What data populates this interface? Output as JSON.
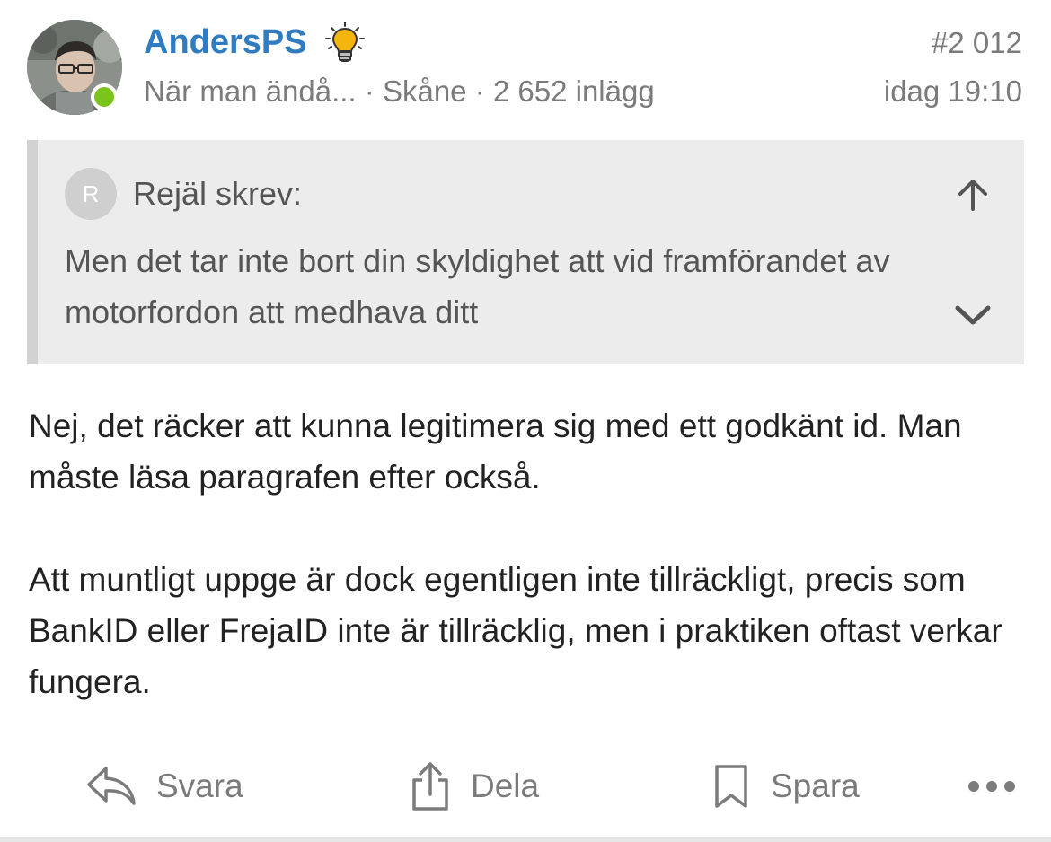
{
  "post": {
    "username": "AndersPS",
    "user_title": "När man ändå...",
    "location": "Skåne",
    "post_count": "2 652 inlägg",
    "separator": " · ",
    "post_number": "#2 012",
    "timestamp": "idag 19:10",
    "online": true,
    "badge_icon": "lightbulb-icon"
  },
  "quote": {
    "avatar_letter": "R",
    "author_line": "Rejäl skrev:",
    "text": "Men det tar inte bort din skyldighet att vid framförandet av motorfordon att medhava ditt",
    "expand_icon": "chevron-down-icon",
    "jump_icon": "arrow-up-icon"
  },
  "body": {
    "paragraph_1": "Nej, det räcker att kunna legitimera sig med ett godkänt id. Man måste läsa paragrafen efter också.",
    "paragraph_2": "Att muntligt uppge är dock egentligen inte tillräckligt, precis som BankID eller FrejaID inte är tillräcklig, men i praktiken oftast verkar fungera."
  },
  "actions": {
    "reply_label": "Svara",
    "share_label": "Dela",
    "save_label": "Spara",
    "more_icon": "more-icon"
  },
  "colors": {
    "username": "#2f7cc0",
    "meta_text": "#7b7b7b",
    "online_dot": "#7bc41c",
    "quote_bg": "#ececec",
    "quote_bar": "#d2d2d2",
    "bulb": "#f5b50f"
  }
}
